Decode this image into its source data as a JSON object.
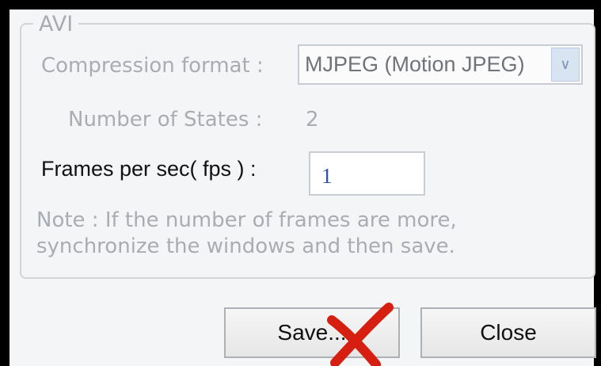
{
  "group": {
    "title": "AVI"
  },
  "compression": {
    "label": "Compression format :",
    "value": "MJPEG (Motion JPEG)"
  },
  "states": {
    "label": "Number of States :",
    "value": "2"
  },
  "fps": {
    "label": "Frames per sec( fps ) :",
    "value": "1"
  },
  "note": {
    "line1": "Note : If the number of frames are more,",
    "line2": "synchronize the windows and then save."
  },
  "buttons": {
    "save": "Save...",
    "close": "Close"
  },
  "icons": {
    "dropdown": "chevron-down-icon",
    "annotation": "red-cross-mark-icon"
  },
  "colors": {
    "annotation": "#d61f10",
    "value_text": "#2e4fae"
  }
}
